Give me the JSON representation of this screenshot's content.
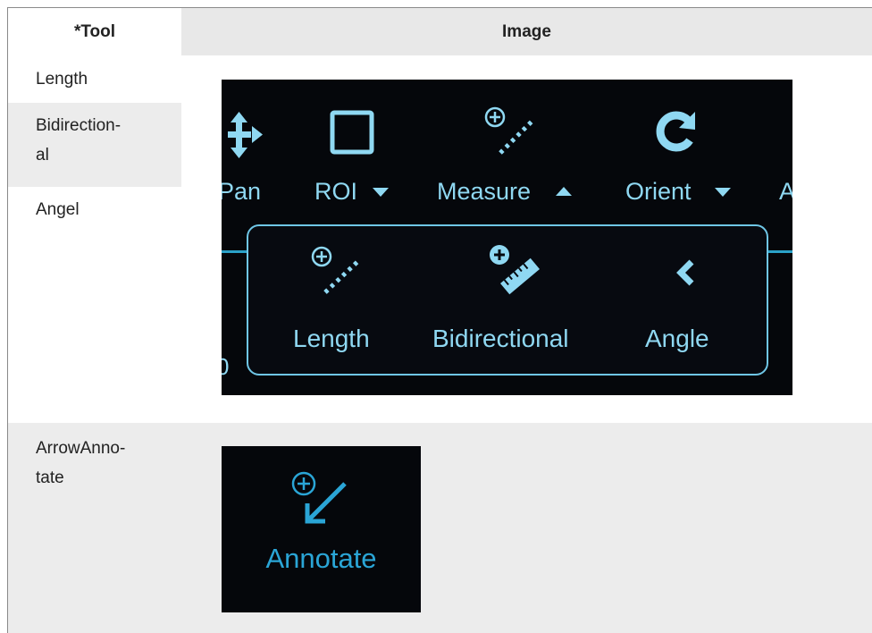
{
  "table": {
    "headers": {
      "tool": "*Tool",
      "image": "Image"
    },
    "rows": [
      {
        "tool": "Length"
      },
      {
        "tool": "Bidirection-al"
      },
      {
        "tool": "Angel"
      },
      {
        "tool": "ArrowAnno-tate"
      }
    ]
  },
  "screenshot_measure": {
    "toolbar": [
      "Pan",
      "ROI",
      "Measure",
      "Orient",
      "A"
    ],
    "submenu": [
      "Length",
      "Bidirectional",
      "Angle"
    ],
    "accent_color": "#8fd8f2"
  },
  "screenshot_annotate": {
    "label": "Annotate",
    "accent_color": "#2aa5d6"
  }
}
